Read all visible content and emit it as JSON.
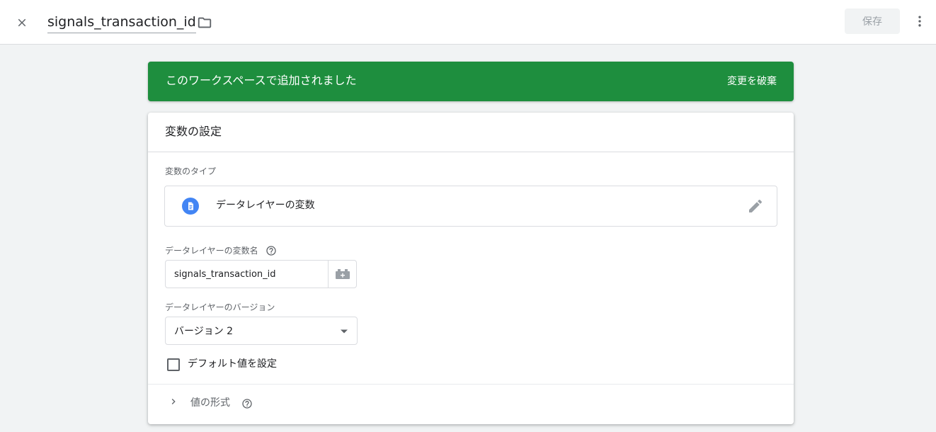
{
  "header": {
    "close_icon": "close-icon",
    "title": "signals_transaction_id",
    "folder_icon": "folder-icon",
    "save_label": "保存",
    "more_icon": "more-vert-icon"
  },
  "banner": {
    "message": "このワークスペースで追加されました",
    "discard_label": "変更を破棄",
    "color": "#1e8e3e"
  },
  "config": {
    "title": "変数の設定",
    "type_label": "変数のタイプ",
    "type_name": "データレイヤーの変数",
    "type_icon": "document-icon",
    "var_name_label": "データレイヤーの変数名",
    "var_name_value": "signals_transaction_id",
    "version_label": "データレイヤーのバージョン",
    "version_value": "バージョン 2",
    "default_checkbox_label": "デフォルト値を設定",
    "format_label": "値の形式"
  }
}
